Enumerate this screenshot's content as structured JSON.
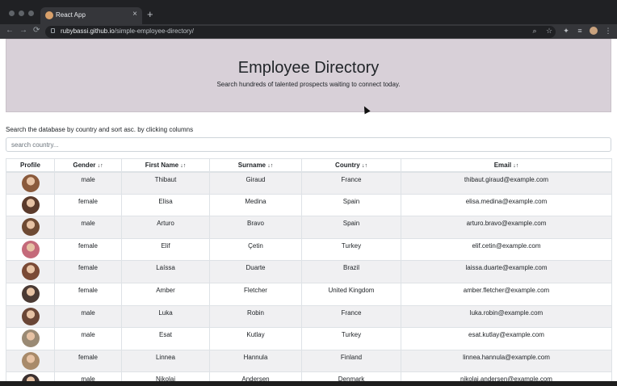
{
  "browser": {
    "tab_title": "React App",
    "tab_close": "×",
    "new_tab": "+",
    "url_host": "rubybassi.github.io",
    "url_path": "/simple-employee-directory/",
    "back": "←",
    "forward": "→",
    "reload": "⟳"
  },
  "hero": {
    "title": "Employee Directory",
    "subtitle": "Search hundreds of talented prospects waiting to connect today."
  },
  "search": {
    "instructions": "Search the database by country and sort asc. by clicking columns",
    "placeholder": "search country..."
  },
  "table": {
    "headers": {
      "profile": "Profile",
      "gender": "Gender",
      "first": "First Name",
      "surname": "Surname",
      "country": "Country",
      "email": "Email"
    },
    "sort_icon": "↓↑",
    "rows": [
      {
        "gender": "male",
        "first": "Thibaut",
        "surname": "Giraud",
        "country": "France",
        "email": "thibaut.giraud@example.com",
        "avatar_color": "#8a5a3c"
      },
      {
        "gender": "female",
        "first": "Elisa",
        "surname": "Medina",
        "country": "Spain",
        "email": "elisa.medina@example.com",
        "avatar_color": "#5b3b2c"
      },
      {
        "gender": "male",
        "first": "Arturo",
        "surname": "Bravo",
        "country": "Spain",
        "email": "arturo.bravo@example.com",
        "avatar_color": "#6e4a33"
      },
      {
        "gender": "female",
        "first": "Elif",
        "surname": "Çetin",
        "country": "Turkey",
        "email": "elif.cetin@example.com",
        "avatar_color": "#c46a7a"
      },
      {
        "gender": "female",
        "first": "Laíssa",
        "surname": "Duarte",
        "country": "Brazil",
        "email": "laissa.duarte@example.com",
        "avatar_color": "#7a4a36"
      },
      {
        "gender": "female",
        "first": "Amber",
        "surname": "Fletcher",
        "country": "United Kingdom",
        "email": "amber.fletcher@example.com",
        "avatar_color": "#4a3a34"
      },
      {
        "gender": "male",
        "first": "Luka",
        "surname": "Robin",
        "country": "France",
        "email": "luka.robin@example.com",
        "avatar_color": "#6a4636"
      },
      {
        "gender": "male",
        "first": "Esat",
        "surname": "Kutlay",
        "country": "Turkey",
        "email": "esat.kutlay@example.com",
        "avatar_color": "#9a8a74"
      },
      {
        "gender": "female",
        "first": "Linnea",
        "surname": "Hannula",
        "country": "Finland",
        "email": "linnea.hannula@example.com",
        "avatar_color": "#a88a6a"
      },
      {
        "gender": "male",
        "first": "Nikolai",
        "surname": "Andersen",
        "country": "Denmark",
        "email": "nikolai.andersen@example.com",
        "avatar_color": "#3a3030"
      }
    ]
  },
  "colors": {
    "hero_background": "#d8d0d8",
    "row_stripe": "#f0f0f2"
  }
}
